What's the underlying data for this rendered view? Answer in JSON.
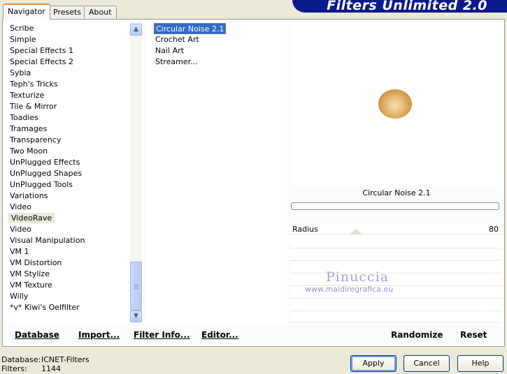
{
  "app": {
    "title": "Filters Unlimited 2.0"
  },
  "tabs": [
    {
      "label": "Navigator",
      "active": true
    },
    {
      "label": "Presets",
      "active": false
    },
    {
      "label": "About",
      "active": false
    }
  ],
  "categories": [
    "Scribe",
    "Simple",
    "Special Effects 1",
    "Special Effects 2",
    "Sybia",
    "Teph's Tricks",
    "Texturize",
    "Tile & Mirror",
    "Toadies",
    "Tramages",
    "Transparency",
    "Two Moon",
    "UnPlugged Effects",
    "UnPlugged Shapes",
    "UnPlugged Tools",
    "Variations",
    "Video",
    "VideoRave",
    "Video",
    "Visual Manipulation",
    "VM 1",
    "VM Distortion",
    "VM Stylize",
    "VM Texture",
    "Willy",
    "*v* Kiwi's Oelfilter"
  ],
  "selected_category": "VideoRave",
  "filters": [
    "Circular Noise 2.1",
    "Crochet Art",
    "Nail Art",
    "Streamer..."
  ],
  "selected_filter": "Circular Noise 2.1",
  "preview": {
    "filter_name": "Circular Noise 2.1"
  },
  "params": [
    {
      "label": "Radius",
      "value": "80"
    }
  ],
  "watermark": {
    "name": "Pinuccia",
    "url": "www.maidiregrafica.eu"
  },
  "toolbar": {
    "database": "Database",
    "import": "Import...",
    "filter_info": "Filter Info...",
    "editor": "Editor...",
    "randomize": "Randomize",
    "reset": "Reset"
  },
  "footer": {
    "database_label": "Database:",
    "database_value": "ICNET-Filters",
    "filters_label": "Filters:",
    "filters_value": "1144"
  },
  "buttons": {
    "apply": "Apply",
    "cancel": "Cancel",
    "help": "Help"
  },
  "colors": {
    "banner": "#0a1a8c",
    "selection": "#316ac5",
    "active_tab_accent": "#e68b2c"
  }
}
